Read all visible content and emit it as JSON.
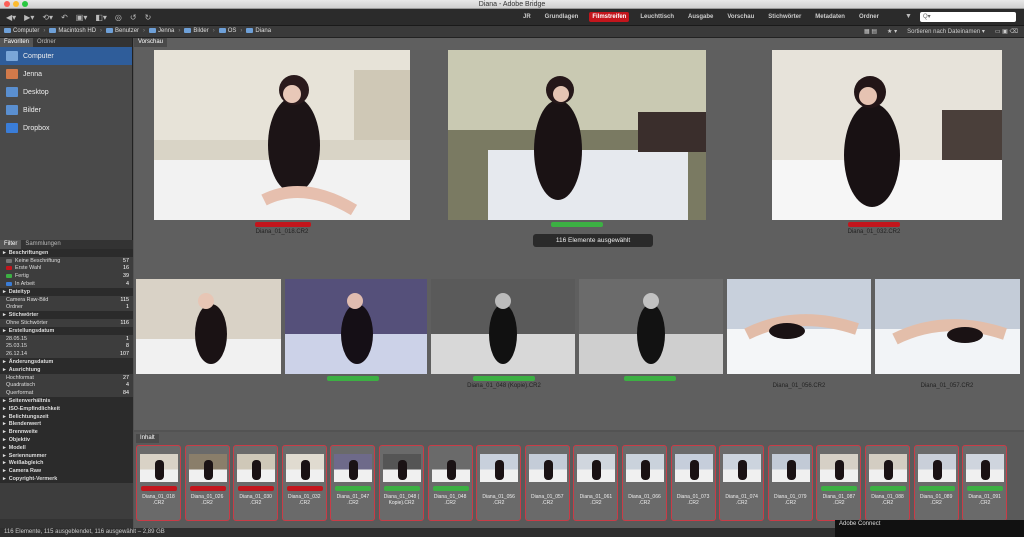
{
  "window": {
    "title": "Diana - Adobe Bridge"
  },
  "workspaces": {
    "items": [
      "JR",
      "Grundlagen",
      "Filmstreifen",
      "Leuchttisch",
      "Ausgabe",
      "Vorschau",
      "Stichwörter",
      "Metadaten",
      "Ordner"
    ],
    "active": "Filmstreifen"
  },
  "search": {
    "placeholder": "Q▾"
  },
  "path": [
    "Computer",
    "Macintosh HD",
    "Benutzer",
    "Jenna",
    "Bilder",
    "OS",
    "Diana"
  ],
  "sort": {
    "label": "Sortieren nach Dateinamen ▾"
  },
  "left_tabs": [
    "Favoriten",
    "Ordner"
  ],
  "favorites": [
    "Computer",
    "Jenna",
    "Desktop",
    "Bilder",
    "Dropbox"
  ],
  "filter_tabs": [
    "Filter",
    "Sammlungen"
  ],
  "filter": [
    {
      "type": "h",
      "label": "Beschriftungen"
    },
    {
      "label": "Keine Beschriftung",
      "count": "57",
      "color": "#777777"
    },
    {
      "label": "Erste Wahl",
      "count": "16",
      "color": "#c3151c"
    },
    {
      "label": "Fertig",
      "count": "39",
      "color": "#3cb043"
    },
    {
      "label": "In Arbeit",
      "count": "4",
      "color": "#3a7dd8"
    },
    {
      "type": "h",
      "label": "Dateityp"
    },
    {
      "label": "Camera Raw-Bild",
      "count": "115"
    },
    {
      "label": "Ordner",
      "count": "1"
    },
    {
      "type": "h",
      "label": "Stichwörter"
    },
    {
      "label": "Ohne Stichwörter",
      "count": "116"
    },
    {
      "type": "h",
      "label": "Erstellungsdatum"
    },
    {
      "label": "28.05.15",
      "count": "1"
    },
    {
      "label": "25.03.15",
      "count": "8"
    },
    {
      "label": "26.12.14",
      "count": "107"
    },
    {
      "type": "h",
      "label": "Änderungsdatum"
    },
    {
      "type": "h",
      "label": "Ausrichtung"
    },
    {
      "label": "Hochformat",
      "count": "27"
    },
    {
      "label": "Quadratisch",
      "count": "4"
    },
    {
      "label": "Querformat",
      "count": "84"
    },
    {
      "type": "h",
      "label": "Seitenverhältnis"
    },
    {
      "type": "h",
      "label": "ISO-Empfindlichkeit"
    },
    {
      "type": "h",
      "label": "Belichtungszeit"
    },
    {
      "type": "h",
      "label": "Blendenwert"
    },
    {
      "type": "h",
      "label": "Brennweite"
    },
    {
      "type": "h",
      "label": "Objektiv"
    },
    {
      "type": "h",
      "label": "Modell"
    },
    {
      "type": "h",
      "label": "Seriennummer"
    },
    {
      "type": "h",
      "label": "Weißabgleich"
    },
    {
      "type": "h",
      "label": "Camera Raw"
    },
    {
      "type": "h",
      "label": "Copyright-Vermerk"
    }
  ],
  "preview": {
    "tab": "Vorschau",
    "toast": "116 Elemente ausgewählt",
    "captions": [
      "Diana_01_018.CR2",
      "",
      "Diana_01_032.CR2",
      "",
      "",
      "Diana_01_048 (Kopie).CR2",
      "",
      "Diana_01_056.CR2",
      "Diana_01_057.CR2"
    ]
  },
  "content": {
    "tab": "Inhalt",
    "thumbs": [
      {
        "line1": "Diana_01_018",
        "line2": ".CR2",
        "label": "#c3151c"
      },
      {
        "line1": "Diana_01_026",
        "line2": ".CR2",
        "label": "#c3151c"
      },
      {
        "line1": "Diana_01_030",
        "line2": ".CR2",
        "label": "#c3151c"
      },
      {
        "line1": "Diana_01_032",
        "line2": ".CR2",
        "label": "#c3151c"
      },
      {
        "line1": "Diana_01_047",
        "line2": ".CR2",
        "label": "#3cb043"
      },
      {
        "line1": "Diana_01_048 (",
        "line2": "Kopie).CR2",
        "label": "#3cb043"
      },
      {
        "line1": "Diana_01_048",
        "line2": ".CR2",
        "label": "#3cb043"
      },
      {
        "line1": "Diana_01_056",
        "line2": ".CR2",
        "label": ""
      },
      {
        "line1": "Diana_01_057",
        "line2": ".CR2",
        "label": ""
      },
      {
        "line1": "Diana_01_061",
        "line2": ".CR2",
        "label": ""
      },
      {
        "line1": "Diana_01_066",
        "line2": ".CR2",
        "label": ""
      },
      {
        "line1": "Diana_01_073",
        "line2": ".CR2",
        "label": ""
      },
      {
        "line1": "Diana_01_074",
        "line2": ".CR2",
        "label": ""
      },
      {
        "line1": "Diana_01_079",
        "line2": ".CR2",
        "label": ""
      },
      {
        "line1": "Diana_01_087",
        "line2": ".CR2",
        "label": "#3cb043"
      },
      {
        "line1": "Diana_01_088",
        "line2": ".CR2",
        "label": "#3cb043"
      },
      {
        "line1": "Diana_01_089",
        "line2": ".CR2",
        "label": "#3cb043"
      },
      {
        "line1": "Diana_01_091",
        "line2": ".CR2",
        "label": "#3cb043"
      }
    ]
  },
  "status": "116 Elemente, 115 ausgeblendet, 116 ausgewählt – 2,89 GB",
  "adobe_connect": "Adobe Connect"
}
